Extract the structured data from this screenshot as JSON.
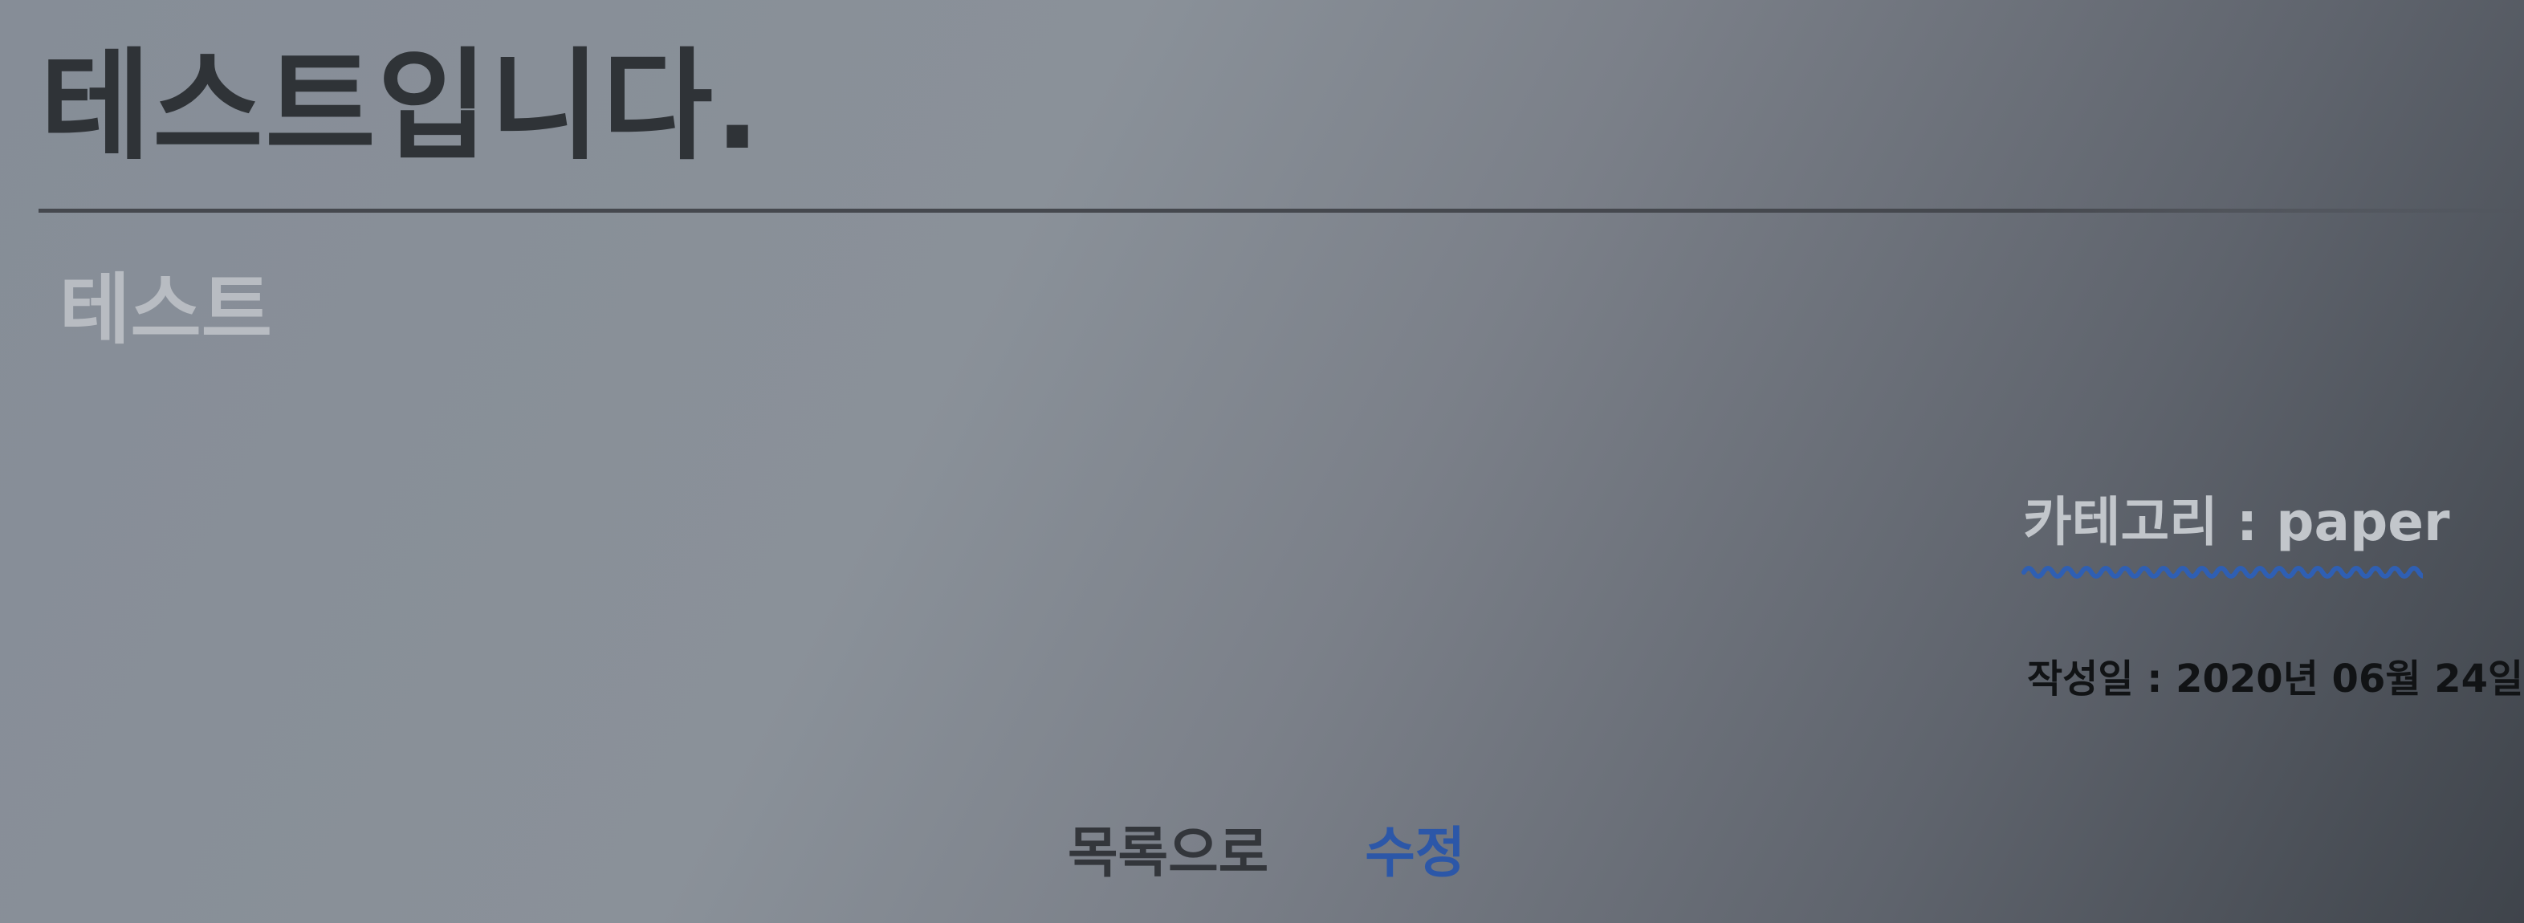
{
  "post": {
    "title": "테스트입니다.",
    "body": "테스트",
    "category_label": "카테고리 : paper",
    "date_label": "작성일 : 2020년 06월 24일"
  },
  "actions": {
    "list_label": "목록으로",
    "edit_label": "수정"
  },
  "colors": {
    "title": "#2f3337",
    "body": "#b8bcc2",
    "edit_link": "#2c57a8",
    "spellcheck_underline": "#2f5fb3",
    "date": "#111315"
  }
}
